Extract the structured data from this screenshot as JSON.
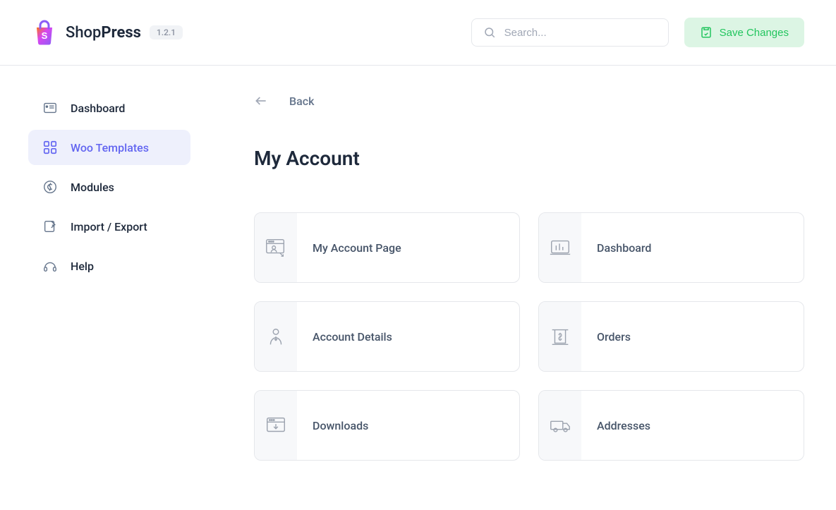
{
  "header": {
    "logo_shop": "Shop",
    "logo_press": "Press",
    "version": "1.2.1",
    "search_placeholder": "Search...",
    "save_button": "Save Changes"
  },
  "sidebar": {
    "items": [
      {
        "label": "Dashboard",
        "icon": "dashboard"
      },
      {
        "label": "Woo Templates",
        "icon": "grid",
        "active": true
      },
      {
        "label": "Modules",
        "icon": "modules"
      },
      {
        "label": "Import / Export",
        "icon": "import-export"
      },
      {
        "label": "Help",
        "icon": "help"
      }
    ]
  },
  "content": {
    "back_label": "Back",
    "page_title": "My Account",
    "tiles": [
      {
        "label": "My Account Page",
        "icon": "account-page"
      },
      {
        "label": "Dashboard",
        "icon": "dashboard-tile"
      },
      {
        "label": "Account Details",
        "icon": "account-details"
      },
      {
        "label": "Orders",
        "icon": "orders"
      },
      {
        "label": "Downloads",
        "icon": "downloads"
      },
      {
        "label": "Addresses",
        "icon": "addresses"
      }
    ]
  }
}
